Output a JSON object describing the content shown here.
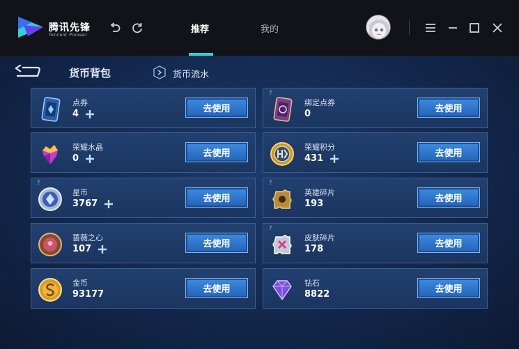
{
  "app": {
    "logo_text": "腾讯先锋",
    "logo_sub": "Tencent Pioneer"
  },
  "nav": {
    "tabs": [
      {
        "label": "推荐",
        "active": true
      },
      {
        "label": "我的",
        "active": false
      }
    ]
  },
  "header": {
    "title": "货币背包",
    "flow_link": "货币流水"
  },
  "colors": {
    "accent": "#2bd2d8",
    "button": "#2f74cc",
    "card_bg": "#1f3b68"
  },
  "currencies": [
    {
      "name": "点券",
      "value": "4",
      "icon": "voucher-card-icon",
      "has_plus": true,
      "has_help": false,
      "button": "去使用"
    },
    {
      "name": "绑定点券",
      "value": "0",
      "icon": "bound-voucher-card-icon",
      "has_plus": false,
      "has_help": true,
      "button": "去使用"
    },
    {
      "name": "荣耀水晶",
      "value": "0",
      "icon": "glory-crystal-icon",
      "has_plus": true,
      "has_help": false,
      "button": "去使用"
    },
    {
      "name": "荣耀积分",
      "value": "431",
      "icon": "glory-points-icon",
      "has_plus": true,
      "has_help": false,
      "button": "去使用"
    },
    {
      "name": "星币",
      "value": "3767",
      "icon": "star-coin-icon",
      "has_plus": true,
      "has_help": true,
      "button": "去使用"
    },
    {
      "name": "英雄碎片",
      "value": "193",
      "icon": "hero-fragment-icon",
      "has_plus": false,
      "has_help": true,
      "button": "去使用"
    },
    {
      "name": "蔷薇之心",
      "value": "107",
      "icon": "rose-heart-icon",
      "has_plus": true,
      "has_help": false,
      "button": "去使用"
    },
    {
      "name": "皮肤碎片",
      "value": "178",
      "icon": "skin-fragment-icon",
      "has_plus": false,
      "has_help": true,
      "button": "去使用"
    },
    {
      "name": "金币",
      "value": "93177",
      "icon": "gold-coin-icon",
      "has_plus": false,
      "has_help": false,
      "button": "去使用"
    },
    {
      "name": "钻石",
      "value": "8822",
      "icon": "diamond-icon",
      "has_plus": false,
      "has_help": false,
      "button": "去使用"
    }
  ]
}
